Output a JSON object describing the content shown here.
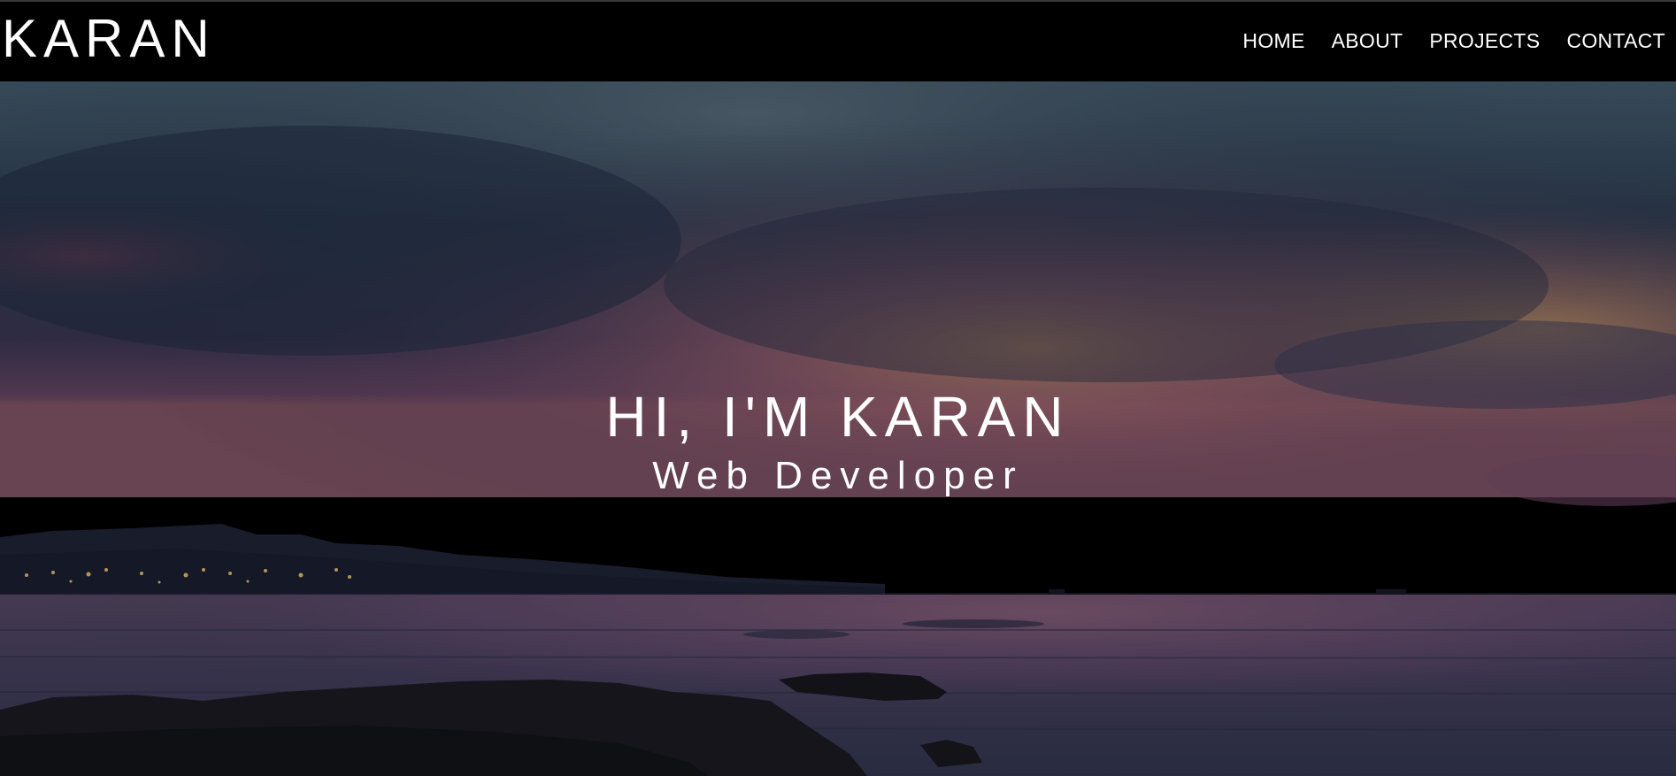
{
  "navbar": {
    "brand": "KARAN",
    "links": [
      {
        "label": "HOME"
      },
      {
        "label": "ABOUT"
      },
      {
        "label": "PROJECTS"
      },
      {
        "label": "CONTACT"
      }
    ]
  },
  "hero": {
    "title": "HI, I'M KARAN",
    "subtitle": "Web Developer",
    "background": "sunset-seascape-photo"
  },
  "colors": {
    "navbar_bg": "#000000",
    "text": "#ffffff"
  }
}
